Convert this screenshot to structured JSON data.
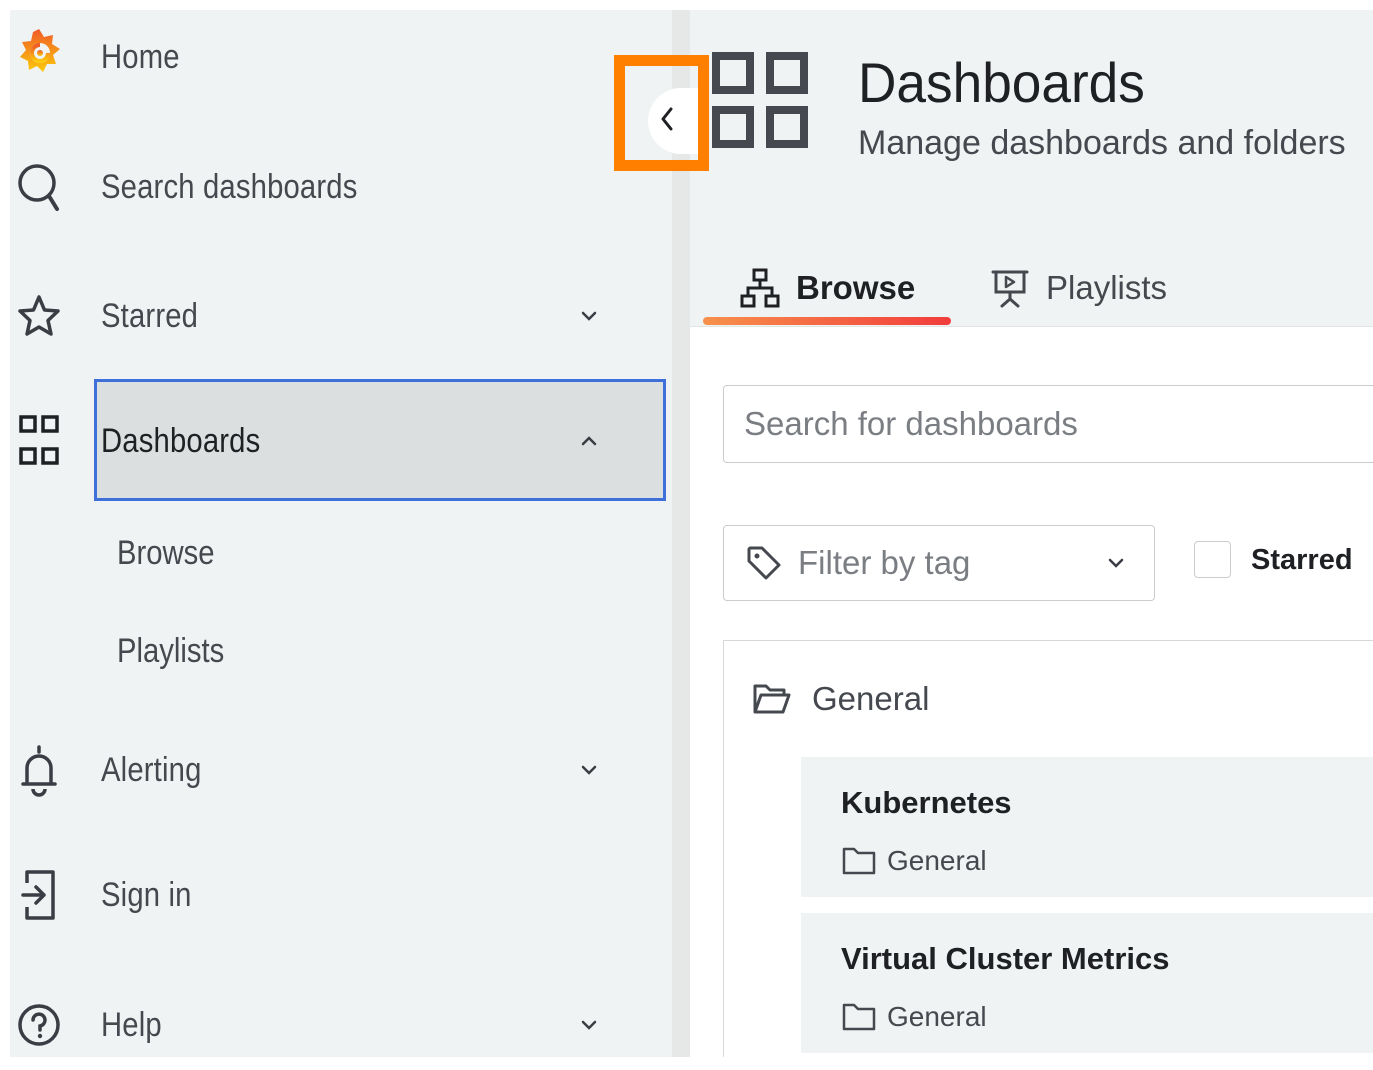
{
  "sidebar": {
    "items": [
      {
        "label": "Home",
        "icon": "grafana-logo-icon"
      },
      {
        "label": "Search dashboards",
        "icon": "search-icon"
      },
      {
        "label": "Starred",
        "icon": "star-icon"
      },
      {
        "label": "Dashboards",
        "icon": "apps-grid-icon"
      },
      {
        "label": "Alerting",
        "icon": "bell-icon"
      },
      {
        "label": "Sign in",
        "icon": "sign-in-icon"
      },
      {
        "label": "Help",
        "icon": "question-circle-icon"
      }
    ],
    "dashboards_sub": [
      "Browse",
      "Playlists"
    ]
  },
  "page": {
    "title": "Dashboards",
    "subtitle": "Manage dashboards and folders"
  },
  "tabs": [
    {
      "label": "Browse",
      "active": true,
      "icon": "sitemap-icon"
    },
    {
      "label": "Playlists",
      "active": false,
      "icon": "presentation-icon"
    }
  ],
  "search": {
    "placeholder": "Search for dashboards"
  },
  "filter": {
    "tag_placeholder": "Filter by tag",
    "starred_label": "Starred"
  },
  "results": {
    "folder": "General",
    "dashboards": [
      {
        "title": "Kubernetes",
        "folder": "General"
      },
      {
        "title": "Virtual Cluster Metrics",
        "folder": "General"
      }
    ]
  },
  "colors": {
    "accent_highlight": "#ff8000",
    "active_border": "#3d71d9",
    "tab_gradient_start": "#f7914b",
    "tab_gradient_end": "#f23c3c",
    "sidebar_bg": "#f0f3f3"
  }
}
